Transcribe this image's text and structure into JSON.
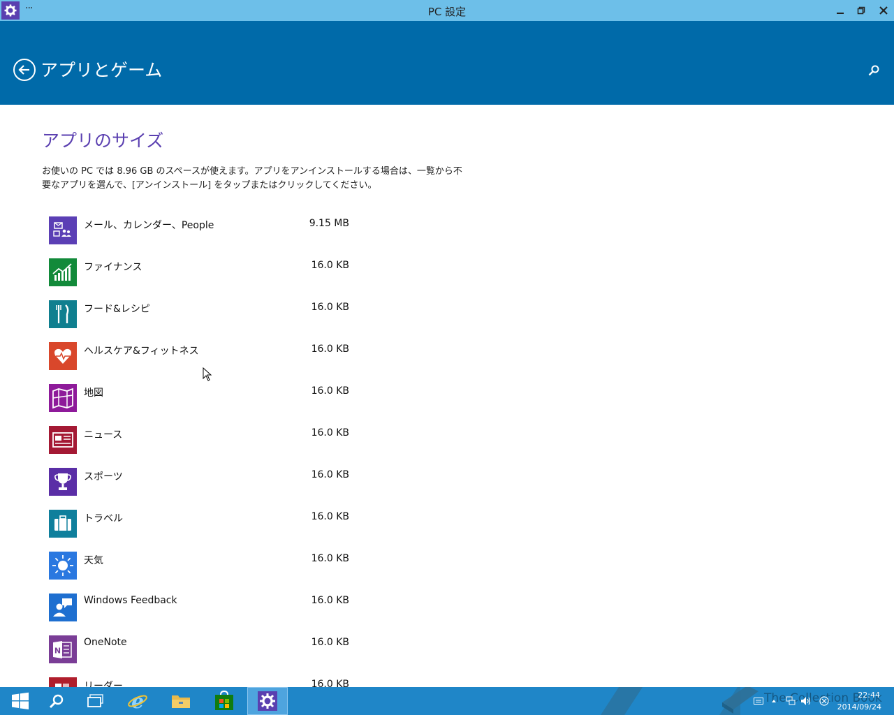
{
  "window": {
    "title": "PC 設定",
    "menu": "···"
  },
  "header": {
    "title": "アプリとゲーム"
  },
  "content": {
    "section_title": "アプリのサイズ",
    "description": "お使いの PC では 8.96 GB のスペースが使えます。アプリをアンインストールする場合は、一覧から不要なアプリを選んで、[アンインストール] をタップまたはクリックしてください。"
  },
  "apps": [
    {
      "name": "メール、カレンダー、People",
      "size": "9.15 MB",
      "color": "#5b3fb5",
      "icon": "mail-calendar-people-icon"
    },
    {
      "name": "ファイナンス",
      "size": "16.0 KB",
      "color": "#128a3a",
      "icon": "finance-icon"
    },
    {
      "name": "フード&レシピ",
      "size": "16.0 KB",
      "color": "#0f7f8f",
      "icon": "food-icon"
    },
    {
      "name": "ヘルスケア&フィットネス",
      "size": "16.0 KB",
      "color": "#d9472b",
      "icon": "health-icon"
    },
    {
      "name": "地図",
      "size": "16.0 KB",
      "color": "#8e1a9a",
      "icon": "maps-icon"
    },
    {
      "name": "ニュース",
      "size": "16.0 KB",
      "color": "#a41934",
      "icon": "news-icon"
    },
    {
      "name": "スポーツ",
      "size": "16.0 KB",
      "color": "#5a2ea6",
      "icon": "sports-icon"
    },
    {
      "name": "トラベル",
      "size": "16.0 KB",
      "color": "#0f7f9c",
      "icon": "travel-icon"
    },
    {
      "name": "天気",
      "size": "16.0 KB",
      "color": "#2a78e0",
      "icon": "weather-icon"
    },
    {
      "name": "Windows Feedback",
      "size": "16.0 KB",
      "color": "#1e6fd0",
      "icon": "feedback-icon"
    },
    {
      "name": "OneNote",
      "size": "16.0 KB",
      "color": "#7a3d96",
      "icon": "onenote-icon"
    },
    {
      "name": "リーダー",
      "size": "16.0 KB",
      "color": "#b01e2c",
      "icon": "reader-icon"
    }
  ],
  "taskbar": {
    "time": "22:44",
    "date": "2014/09/24",
    "watermark": "The Collection Book"
  }
}
